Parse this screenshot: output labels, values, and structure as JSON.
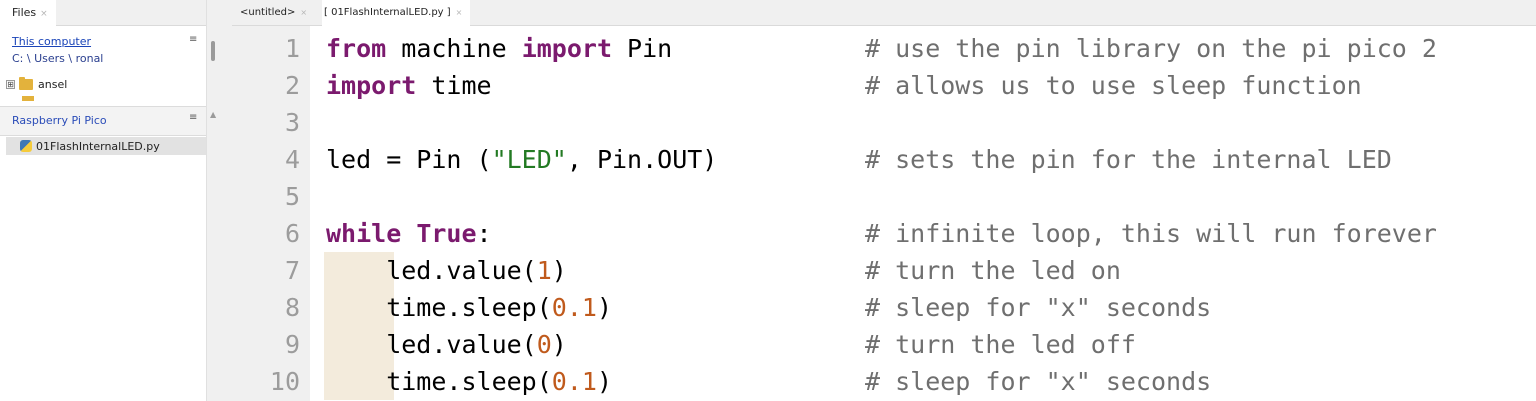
{
  "files_pane": {
    "tab_label": "Files",
    "this_computer_label": "This computer",
    "path": "C: \\ Users \\ ronal",
    "tree_items": [
      {
        "label": "ansel",
        "expander": "⊞"
      }
    ],
    "pico_header": "Raspberry Pi Pico",
    "pico_files": [
      {
        "label": "01FlashInternalLED.py"
      }
    ]
  },
  "editor": {
    "tabs": [
      {
        "label": "<untitled>"
      },
      {
        "label": "[ 01FlashInternalLED.py ]"
      }
    ],
    "lines": [
      {
        "num": "1",
        "parts": [
          {
            "text": "from",
            "cls": "kw"
          },
          {
            "text": " machine ",
            "cls": ""
          },
          {
            "text": "import",
            "cls": "kw"
          },
          {
            "text": " Pin",
            "cls": ""
          }
        ],
        "comment": "# use the pin library on the pi pico 2"
      },
      {
        "num": "2",
        "parts": [
          {
            "text": "import",
            "cls": "kw"
          },
          {
            "text": " time",
            "cls": ""
          }
        ],
        "comment": "# allows us to use sleep function"
      },
      {
        "num": "3",
        "parts": [],
        "comment": ""
      },
      {
        "num": "4",
        "parts": [
          {
            "text": "led = Pin (",
            "cls": ""
          },
          {
            "text": "\"LED\"",
            "cls": "str"
          },
          {
            "text": ", Pin.OUT)",
            "cls": ""
          }
        ],
        "comment": "# sets the pin for the internal LED"
      },
      {
        "num": "5",
        "parts": [],
        "comment": ""
      },
      {
        "num": "6",
        "parts": [
          {
            "text": "while",
            "cls": "kw"
          },
          {
            "text": " ",
            "cls": ""
          },
          {
            "text": "True",
            "cls": "kw"
          },
          {
            "text": ":",
            "cls": ""
          }
        ],
        "comment": "# infinite loop, this will run forever"
      },
      {
        "num": "7",
        "parts": [
          {
            "text": "    led.value(",
            "cls": ""
          },
          {
            "text": "1",
            "cls": "num"
          },
          {
            "text": ")",
            "cls": ""
          }
        ],
        "comment": "# turn the led on"
      },
      {
        "num": "8",
        "parts": [
          {
            "text": "    time.sleep(",
            "cls": ""
          },
          {
            "text": "0.1",
            "cls": "num"
          },
          {
            "text": ")",
            "cls": ""
          }
        ],
        "comment": "# sleep for \"x\" seconds"
      },
      {
        "num": "9",
        "parts": [
          {
            "text": "    led.value(",
            "cls": ""
          },
          {
            "text": "0",
            "cls": "num"
          },
          {
            "text": ")",
            "cls": ""
          }
        ],
        "comment": "# turn the led off"
      },
      {
        "num": "10",
        "parts": [
          {
            "text": "    time.sleep(",
            "cls": ""
          },
          {
            "text": "0.1",
            "cls": "num"
          },
          {
            "text": ")",
            "cls": ""
          }
        ],
        "comment": "# sleep for \"x\" seconds"
      }
    ]
  },
  "colors": {
    "keyword": "#7b1a6e",
    "string": "#237a23",
    "number": "#c05a1c",
    "comment": "#6f6f6f",
    "link": "#1a44b8"
  }
}
